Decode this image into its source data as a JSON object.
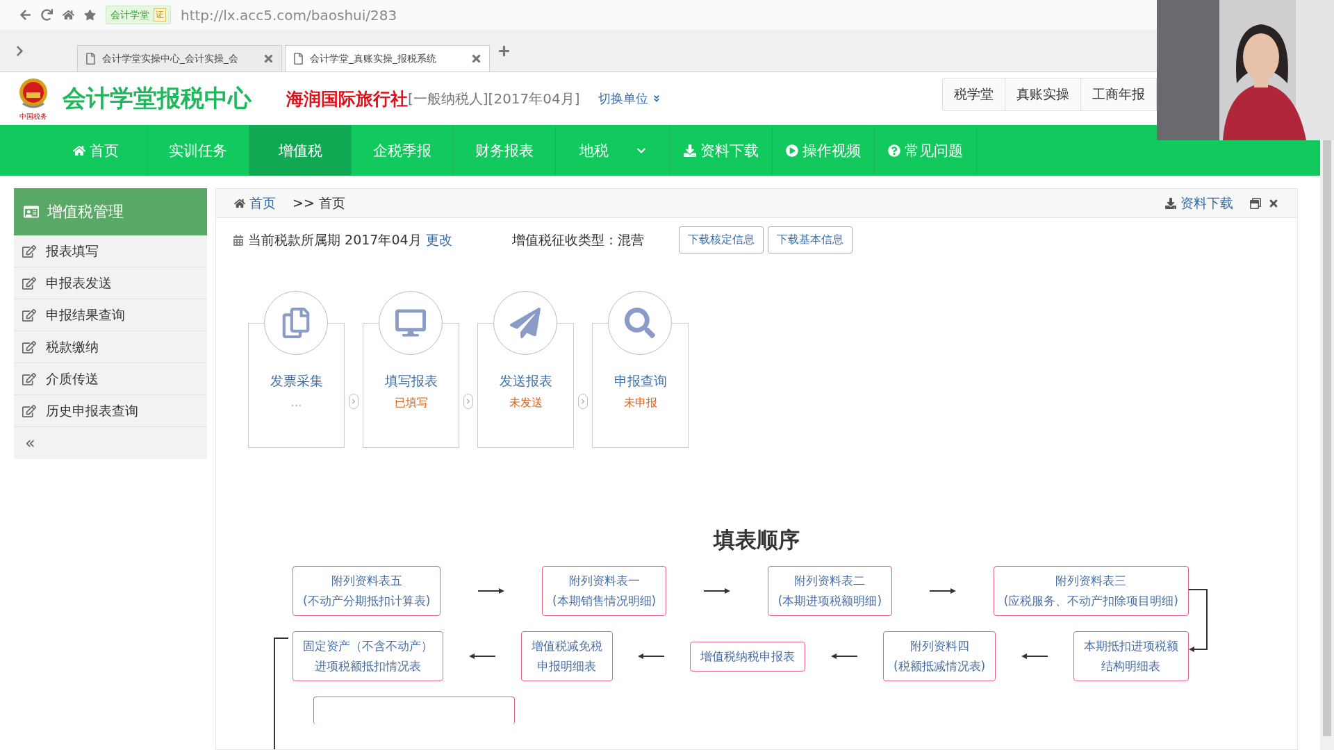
{
  "browser": {
    "site_badge": "会计学堂",
    "cert_badge": "证",
    "url": "http://lx.acc5.com/baoshui/283",
    "tabs": [
      {
        "title": "会计学堂实操中心_会计实操_会",
        "selected": false
      },
      {
        "title": "会计学堂_真账实操_报税系统",
        "selected": true
      }
    ]
  },
  "header": {
    "title": "会计学堂报税中心",
    "emblem_caption": "中国税务",
    "company": "海润国际旅行社",
    "company_info": "[一般纳税人][2017年04月]",
    "switch_unit": "切换单位",
    "links": [
      "税学堂",
      "真账实操",
      "工商年报"
    ]
  },
  "nav": [
    {
      "label": "首页",
      "selected": false,
      "dropdown": false
    },
    {
      "label": "实训任务",
      "selected": false,
      "dropdown": false
    },
    {
      "label": "增值税",
      "selected": true,
      "dropdown": false
    },
    {
      "label": "企税季报",
      "selected": false,
      "dropdown": false
    },
    {
      "label": "财务报表",
      "selected": false,
      "dropdown": false
    },
    {
      "label": "地税",
      "selected": false,
      "dropdown": true
    },
    {
      "label": "资料下载",
      "selected": false,
      "dropdown": false
    },
    {
      "label": "操作视频",
      "selected": false,
      "dropdown": false
    },
    {
      "label": "常见问题",
      "selected": false,
      "dropdown": false
    }
  ],
  "sidebar": {
    "title": "增值税管理",
    "items": [
      "报表填写",
      "申报表发送",
      "申报结果查询",
      "税款缴纳",
      "介质传送",
      "历史申报表查询"
    ],
    "collapse": "«"
  },
  "breadcrumb": {
    "home": "首页",
    "current": ">> 首页",
    "download": "资料下载"
  },
  "info": {
    "period": "当前税款所属期 2017年04月",
    "change": "更改",
    "type": "增值税征收类型：混营",
    "buttons": [
      "下载核定信息",
      "下载基本信息"
    ]
  },
  "steps": [
    {
      "title": "发票采集",
      "status": "…",
      "highlighted": false
    },
    {
      "title": "填写报表",
      "status": "已填写",
      "highlighted": true
    },
    {
      "title": "发送报表",
      "status": "未发送",
      "highlighted": true
    },
    {
      "title": "申报查询",
      "status": "未申报",
      "highlighted": true
    }
  ],
  "flow": {
    "title": "填表顺序",
    "rows": [
      {
        "kind": "forward",
        "items": [
          {
            "lines": [
              "附列资料表五",
              "(不动产分期抵扣计算表)"
            ]
          },
          {
            "lines": [
              "附列资料表一",
              "(本期销售情况明细)"
            ]
          },
          {
            "lines": [
              "附列资料表二",
              "(本期进项税额明细)"
            ]
          },
          {
            "lines": [
              "附列资料表三",
              "(应税服务、不动产扣除项目明细)"
            ]
          }
        ]
      },
      {
        "kind": "backward",
        "items": [
          {
            "lines": [
              "固定资产（不含不动产）",
              "进项税额抵扣情况表"
            ]
          },
          {
            "lines": [
              "增值税减免税",
              "申报明细表"
            ]
          },
          {
            "lines": [
              "增值税纳税申报表"
            ]
          },
          {
            "lines": [
              "附列资料四",
              "(税额抵减情况表)"
            ]
          },
          {
            "lines": [
              "本期抵扣进项税额",
              "结构明细表"
            ]
          }
        ]
      }
    ]
  }
}
